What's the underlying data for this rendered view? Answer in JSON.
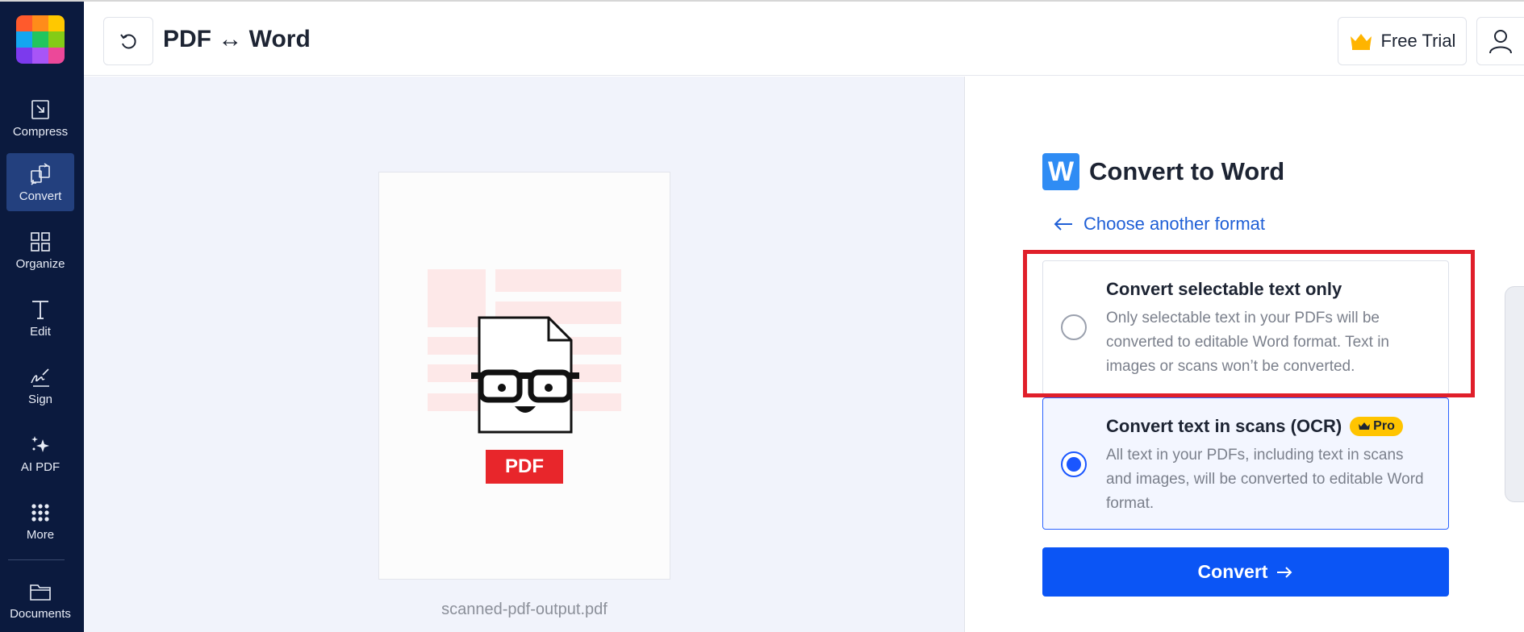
{
  "header": {
    "title": "PDF ↔ Word",
    "trial_label": "Free Trial"
  },
  "sidebar": {
    "items": [
      {
        "label": "Compress"
      },
      {
        "label": "Convert"
      },
      {
        "label": "Organize"
      },
      {
        "label": "Edit"
      },
      {
        "label": "Sign"
      },
      {
        "label": "AI PDF"
      },
      {
        "label": "More"
      },
      {
        "label": "Documents"
      }
    ]
  },
  "preview": {
    "badge": "PDF",
    "filename": "scanned-pdf-output.pdf"
  },
  "panel": {
    "icon_letter": "W",
    "title": "Convert to Word",
    "back_link": "Choose another format",
    "options": [
      {
        "title": "Convert selectable text only",
        "description": "Only selectable text in your PDFs will be converted to editable Word format. Text in images or scans won’t be converted.",
        "selected": false
      },
      {
        "title": "Convert text in scans (OCR)",
        "badge": "Pro",
        "description": "All text in your PDFs, including text in scans and images, will be converted to editable Word format.",
        "selected": true
      }
    ],
    "convert_label": "Convert"
  },
  "colors": {
    "sidebar_bg": "#0b1a3e",
    "primary": "#0b55f5",
    "highlight": "#e01f2a",
    "pdf_badge": "#e8262b",
    "pro_badge": "#ffc400"
  }
}
